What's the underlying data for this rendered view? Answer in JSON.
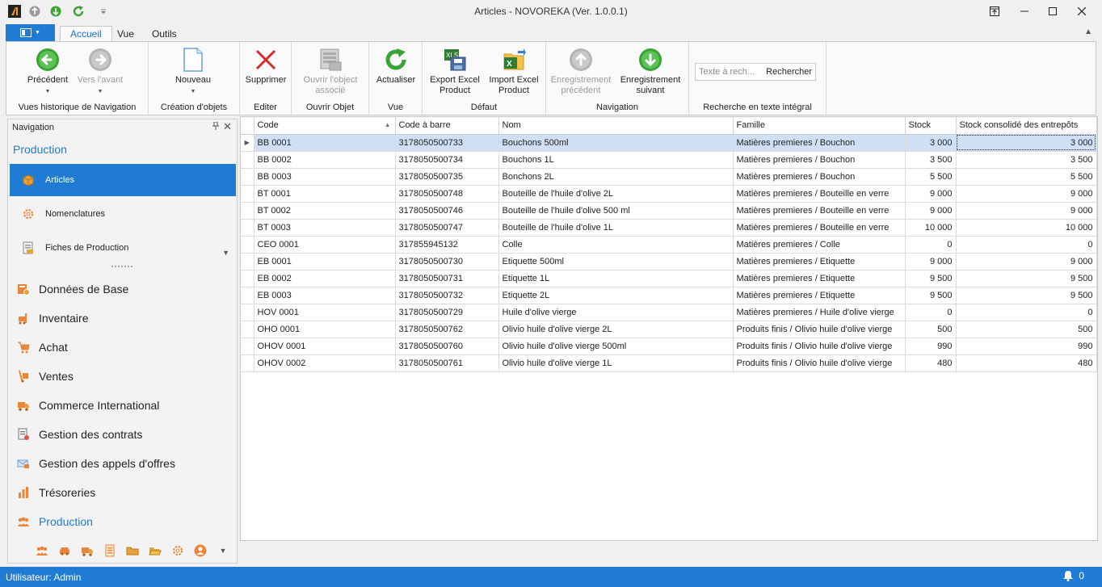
{
  "window": {
    "title": "Articles - NOVOREKA (Ver. 1.0.0.1)"
  },
  "tabs": [
    "Accueil",
    "Vue",
    "Outils"
  ],
  "ribbon": {
    "groups": {
      "history": "Vues historique de Navigation",
      "create": "Création d'objets",
      "edit": "Editer",
      "open": "Ouvrir Objet",
      "view": "Vue",
      "default": "Défaut",
      "navigation": "Navigation",
      "search": "Recherche en texte intégral"
    },
    "buttons": {
      "previous": "Précédent",
      "forward": "Vers l'avant",
      "new": "Nouveau",
      "delete": "Supprimer",
      "open_object_1": "Ouvrir l'object",
      "open_object_2": "associé",
      "refresh": "Actualiser",
      "export_1": "Export Excel",
      "export_2": "Product",
      "import_1": "Import Excel",
      "import_2": "Product",
      "prev_record_1": "Enregistrement",
      "prev_record_2": "précédent",
      "next_record_1": "Enregistrement",
      "next_record_2": "suivant"
    },
    "search": {
      "placeholder": "Texte à rech...",
      "button": "Rechercher"
    }
  },
  "navigation": {
    "header": "Navigation",
    "section": "Production",
    "sub_items": [
      {
        "label": "Articles",
        "icon": "box-icon"
      },
      {
        "label": "Nomenclatures",
        "icon": "gear-icon"
      },
      {
        "label": "Fiches de Production",
        "icon": "sheet-icon"
      }
    ],
    "groups": [
      {
        "label": "Données de Base",
        "icon": "database-icon"
      },
      {
        "label": "Inventaire",
        "icon": "forklift-icon"
      },
      {
        "label": "Achat",
        "icon": "cart-icon"
      },
      {
        "label": "Ventes",
        "icon": "hand-truck-icon"
      },
      {
        "label": "Commerce International",
        "icon": "truck-icon"
      },
      {
        "label": "Gestion des contrats",
        "icon": "contract-icon"
      },
      {
        "label": "Gestion des appels d'offres",
        "icon": "tender-icon"
      },
      {
        "label": "Trésoreries",
        "icon": "bar-chart-icon"
      },
      {
        "label": "Production",
        "icon": "people-icon"
      }
    ]
  },
  "grid": {
    "columns": [
      "Code",
      "Code à barre",
      "Nom",
      "Famille",
      "Stock",
      "Stock consolidé des entrepôts"
    ],
    "rows": [
      [
        "BB 0001",
        "3178050500733",
        "Bouchons 500ml",
        "Matières premieres / Bouchon",
        "3 000",
        "3 000"
      ],
      [
        "BB 0002",
        "3178050500734",
        "Bouchons 1L",
        "Matières premieres / Bouchon",
        "3 500",
        "3 500"
      ],
      [
        "BB 0003",
        "3178050500735",
        "Bonchons 2L",
        "Matières premieres / Bouchon",
        "5 500",
        "5 500"
      ],
      [
        "BT 0001",
        "3178050500748",
        "Bouteille de l'huile d'olive 2L",
        "Matières premieres / Bouteille en verre",
        "9 000",
        "9 000"
      ],
      [
        "BT 0002",
        "3178050500746",
        "Bouteille de l'huile d'olive 500 ml",
        "Matières premieres / Bouteille en verre",
        "9 000",
        "9 000"
      ],
      [
        "BT 0003",
        "3178050500747",
        "Bouteille de l'huile d'olive 1L",
        "Matières premieres / Bouteille en verre",
        "10 000",
        "10 000"
      ],
      [
        "CEO 0001",
        "317855945132",
        "Colle",
        "Matières premieres / Colle",
        "0",
        "0"
      ],
      [
        "EB 0001",
        "3178050500730",
        "Etiquette 500ml",
        "Matières premieres / Etiquette",
        "9 000",
        "9 000"
      ],
      [
        "EB 0002",
        "3178050500731",
        "Etiquette 1L",
        "Matières premieres / Etiquette",
        "9 500",
        "9 500"
      ],
      [
        "EB 0003",
        "3178050500732",
        "Etiquette 2L",
        "Matières premieres / Etiquette",
        "9 500",
        "9 500"
      ],
      [
        "HOV 0001",
        "3178050500729",
        "Huile d'olive vierge",
        "Matières premieres / Huile d'olive vierge",
        "0",
        "0"
      ],
      [
        "OHO 0001",
        "3178050500762",
        "Olivio huile d'olive vierge 2L",
        "Produits finis  / Olivio huile d'olive vierge",
        "500",
        "500"
      ],
      [
        "OHOV 0001",
        "3178050500760",
        "Olivio huile d'olive vierge 500ml",
        "Produits finis  / Olivio huile d'olive vierge",
        "990",
        "990"
      ],
      [
        "OHOV 0002",
        "3178050500761",
        "Olivio huile d'olive vierge 1L",
        "Produits finis  / Olivio huile d'olive vierge",
        "480",
        "480"
      ]
    ]
  },
  "status": {
    "user": "Utilisateur: Admin",
    "notifications": "0"
  }
}
